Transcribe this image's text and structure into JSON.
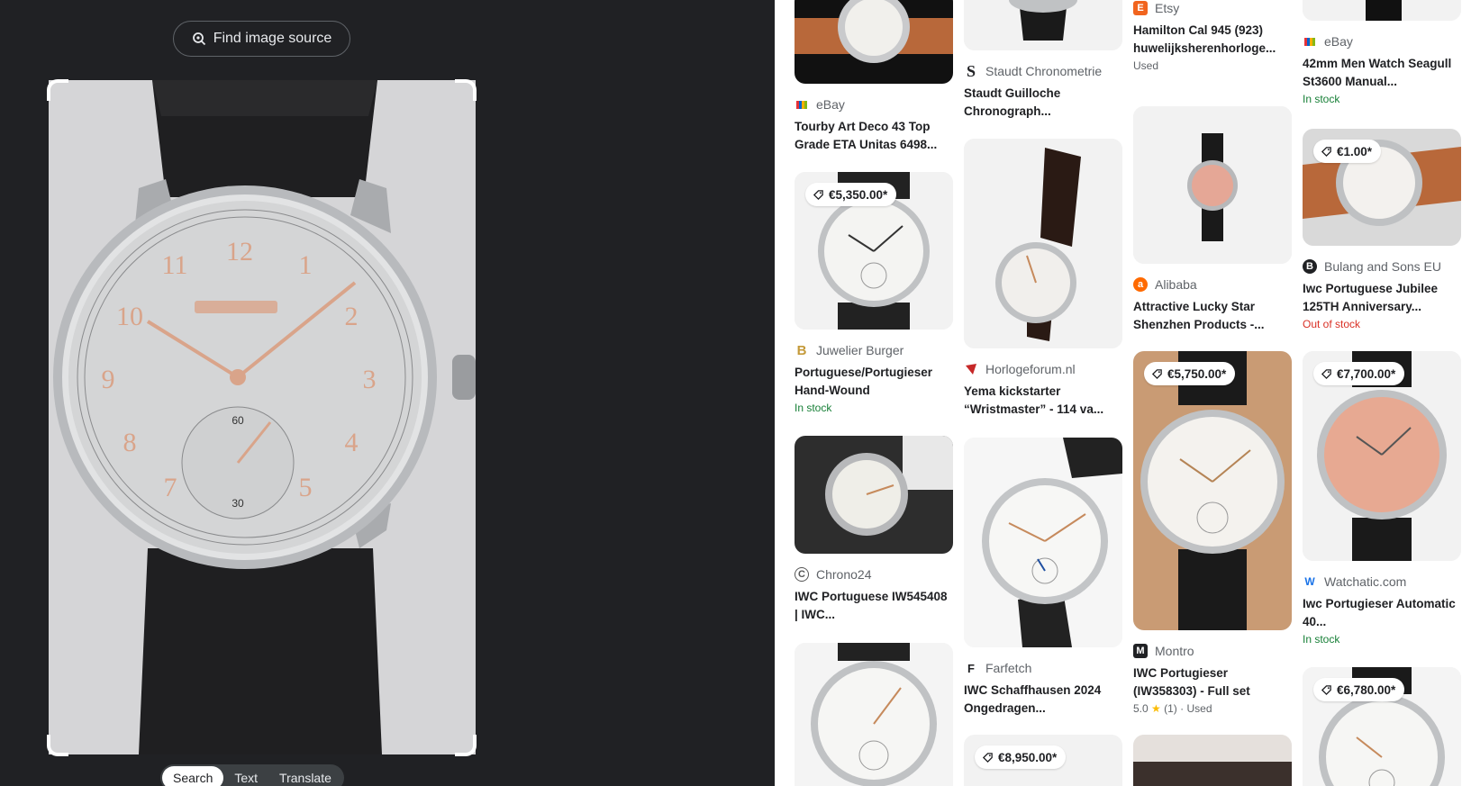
{
  "lens": {
    "find_source_label": "Find image source",
    "tabs": [
      {
        "label": "Search",
        "active": true
      },
      {
        "label": "Text",
        "active": false
      },
      {
        "label": "Translate",
        "active": false
      }
    ]
  },
  "results": {
    "col1": [
      {
        "source": "eBay",
        "title": "Tourby Art Deco 43 Top Grade ETA Unitas 6498...",
        "status": ""
      },
      {
        "price": "€5,350.00*",
        "source": "Juwelier Burger",
        "title": "Portuguese/Portugieser Hand-Wound",
        "status": "In stock"
      },
      {
        "source": "Chrono24",
        "title": "IWC Portuguese IW545408 | IWC...",
        "status": ""
      },
      {
        "price": "",
        "source": "",
        "title": "",
        "status": ""
      }
    ],
    "col2": [
      {
        "source": "Staudt Chronometrie",
        "title": "Staudt Guilloche Chronograph...",
        "status": ""
      },
      {
        "source": "Horlogeforum.nl",
        "title": "Yema kickstarter “Wristmaster” - 114 va...",
        "status": ""
      },
      {
        "source": "Farfetch",
        "title": "IWC Schaffhausen 2024 Ongedragen...",
        "status": ""
      },
      {
        "price": "€8,950.00*"
      }
    ],
    "col3": [
      {
        "source": "Etsy",
        "title": "Hamilton Cal 945 (923) huwelijksherenhorloge...",
        "status": "Used"
      },
      {
        "source": "Alibaba",
        "title": "Attractive Lucky Star Shenzhen Products -...",
        "status": ""
      },
      {
        "price": "€5,750.00*",
        "source": "Montro",
        "title": "IWC Portugieser (IW358303) - Full set",
        "rating": "5.0",
        "rating_count": "(1)",
        "status": "Used"
      }
    ],
    "col4": [
      {
        "source": "eBay",
        "title": "42mm Men Watch Seagull St3600 Manual...",
        "status": "In stock"
      },
      {
        "price": "€1.00*",
        "source": "Bulang and Sons EU",
        "title": "Iwc Portuguese Jubilee 125TH Anniversary...",
        "status": "Out of stock"
      },
      {
        "price": "€7,700.00*",
        "source": "Watchatic.com",
        "title": "Iwc Portugieser Automatic 40...",
        "status": "In stock"
      },
      {
        "price": "€6,780.00*"
      }
    ]
  },
  "colors": {
    "dark_bg": "#202124",
    "in_stock": "#188038",
    "out_of_stock": "#d93025"
  }
}
